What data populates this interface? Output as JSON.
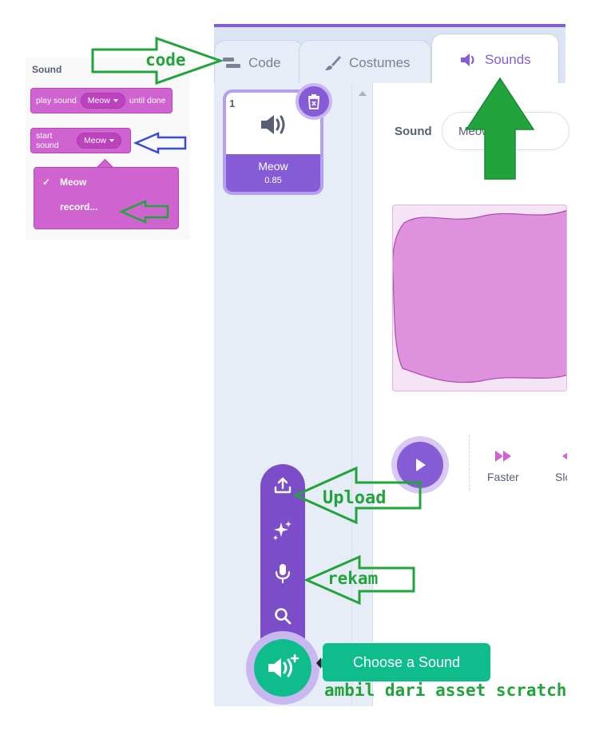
{
  "palette": {
    "category_title": "Sound",
    "play_until_done": {
      "prefix": "play sound",
      "menu": "Meow",
      "suffix": "until done"
    },
    "start_sound": {
      "prefix": "start sound",
      "menu": "Meow"
    },
    "dropdown": {
      "checkmark": "✓",
      "selected": "Meow",
      "record": "record..."
    }
  },
  "tabs": [
    {
      "label": "Code"
    },
    {
      "label": "Costumes"
    },
    {
      "label": "Sounds"
    }
  ],
  "sound_list": [
    {
      "index": "1",
      "name": "Meow",
      "duration": "0.85"
    }
  ],
  "editor": {
    "sound_label": "Sound",
    "sound_name": "Meow",
    "effects": [
      {
        "label": "Faster"
      },
      {
        "label": "Slo"
      }
    ]
  },
  "choose_sound": {
    "tooltip": "Choose a Sound"
  },
  "annotations": {
    "code": "code",
    "upload": "Upload",
    "rekam": "rekam",
    "asset": "ambil dari asset scratch"
  },
  "colors": {
    "block": "#cf63cf",
    "accent": "#855cd6",
    "green_fab": "#0fbd8c",
    "annotation_green": "#22a43c",
    "annotation_blue": "#3b4bd1"
  },
  "icons": {
    "tab_code": "code-icon",
    "tab_costumes": "brush-icon",
    "tab_sounds": "speaker-icon",
    "fab_menu": [
      "upload-icon",
      "surprise-sparkle-icon",
      "microphone-icon",
      "search-icon"
    ],
    "fab": "speaker-plus-icon"
  }
}
